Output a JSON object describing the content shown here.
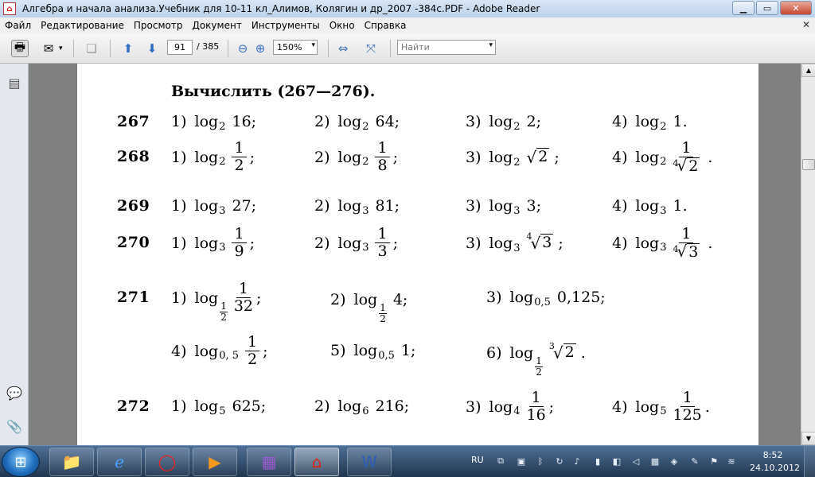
{
  "window": {
    "title": "Алгебра и начала анализа.Учебник для 10-11 кл_Алимов, Колягин и др_2007 -384с.PDF - Adobe Reader",
    "minimize": "▁",
    "maximize": "▭",
    "close": "✕"
  },
  "menu": {
    "items": [
      "Файл",
      "Редактирование",
      "Просмотр",
      "Документ",
      "Инструменты",
      "Окно",
      "Справка"
    ],
    "close_doc": "✕"
  },
  "toolbar": {
    "page_current": "91",
    "page_total": "/ 385",
    "zoom": "150%",
    "find_placeholder": "Найти"
  },
  "document": {
    "heading": "Вычислить (267—276).",
    "problems": [
      {
        "number": "267",
        "items": [
          {
            "label": "1)",
            "base": "2",
            "arg": "16;"
          },
          {
            "label": "2)",
            "base": "2",
            "arg": "64;"
          },
          {
            "label": "3)",
            "base": "2",
            "arg": "2;"
          },
          {
            "label": "4)",
            "base": "2",
            "arg": "1."
          }
        ]
      },
      {
        "number": "268",
        "items": [
          {
            "label": "1)",
            "base": "2",
            "frac_num": "1",
            "frac_den": "2",
            "suffix": ";"
          },
          {
            "label": "2)",
            "base": "2",
            "frac_num": "1",
            "frac_den": "8",
            "suffix": ";"
          },
          {
            "label": "3)",
            "base": "2",
            "radicand": "2",
            "suffix": ";"
          },
          {
            "label": "4)",
            "base": "2",
            "frac_num": "1",
            "root_index": "4",
            "radicand": "2",
            "suffix": "."
          }
        ]
      },
      {
        "number": "269",
        "items": [
          {
            "label": "1)",
            "base": "3",
            "arg": "27;"
          },
          {
            "label": "2)",
            "base": "3",
            "arg": "81;"
          },
          {
            "label": "3)",
            "base": "3",
            "arg": "3;"
          },
          {
            "label": "4)",
            "base": "3",
            "arg": "1."
          }
        ]
      },
      {
        "number": "270",
        "items": [
          {
            "label": "1)",
            "base": "3",
            "frac_num": "1",
            "frac_den": "9",
            "suffix": ";"
          },
          {
            "label": "2)",
            "base": "3",
            "frac_num": "1",
            "frac_den": "3",
            "suffix": ";"
          },
          {
            "label": "3)",
            "base": "3",
            "root_index": "4",
            "radicand": "3",
            "suffix": ";"
          },
          {
            "label": "4)",
            "base": "3",
            "frac_num": "1",
            "root_index": "4",
            "radicand": "3",
            "suffix": "."
          }
        ]
      },
      {
        "number": "271",
        "items": [
          {
            "label": "1)",
            "base_num": "1",
            "base_den": "2",
            "frac_num": "1",
            "frac_den": "32",
            "suffix": ";"
          },
          {
            "label": "2)",
            "base_num": "1",
            "base_den": "2",
            "arg": "4;"
          },
          {
            "label": "3)",
            "base": "0,5",
            "arg": "0,125;"
          },
          {
            "label": "4)",
            "base": "0, 5",
            "frac_num": "1",
            "frac_den": "2",
            "suffix": ";"
          },
          {
            "label": "5)",
            "base": "0,5",
            "arg": "1;"
          },
          {
            "label": "6)",
            "base_num": "1",
            "base_den": "2",
            "root_index": "3",
            "radicand": "2",
            "suffix": "."
          }
        ]
      },
      {
        "number": "272",
        "items": [
          {
            "label": "1)",
            "base": "5",
            "arg": "625;"
          },
          {
            "label": "2)",
            "base": "6",
            "arg": "216;"
          },
          {
            "label": "3)",
            "base": "4",
            "frac_num": "1",
            "frac_den": "16",
            "suffix": ";"
          },
          {
            "label": "4)",
            "base": "5",
            "frac_num": "1",
            "frac_den": "125",
            "suffix": "."
          }
        ]
      }
    ],
    "log_word": "log",
    "radical_sign": "√"
  },
  "taskbar": {
    "language": "RU",
    "time": "8:52",
    "date": "24.10.2012"
  }
}
